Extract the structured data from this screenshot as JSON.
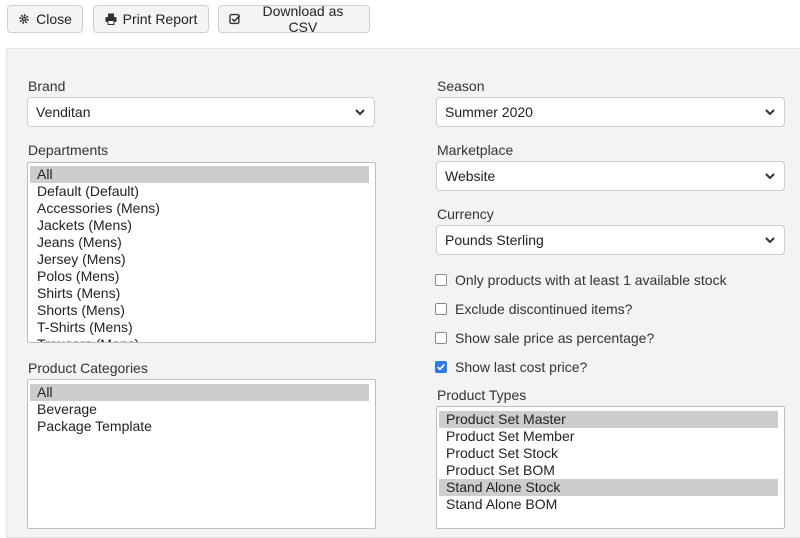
{
  "toolbar": {
    "close_label": "Close",
    "print_label": "Print Report",
    "csv_label": "Download as CSV"
  },
  "form": {
    "brand": {
      "label": "Brand",
      "value": "Venditan"
    },
    "departments": {
      "label": "Departments",
      "options": [
        {
          "text": "All",
          "selected": true
        },
        {
          "text": "Default (Default)",
          "selected": false
        },
        {
          "text": "Accessories (Mens)",
          "selected": false
        },
        {
          "text": "Jackets (Mens)",
          "selected": false
        },
        {
          "text": "Jeans (Mens)",
          "selected": false
        },
        {
          "text": "Jersey (Mens)",
          "selected": false
        },
        {
          "text": "Polos (Mens)",
          "selected": false
        },
        {
          "text": "Shirts (Mens)",
          "selected": false
        },
        {
          "text": "Shorts (Mens)",
          "selected": false
        },
        {
          "text": "T-Shirts (Mens)",
          "selected": false
        },
        {
          "text": "Trousers (Mens)",
          "selected": false
        }
      ]
    },
    "product_categories": {
      "label": "Product Categories",
      "options": [
        {
          "text": "All",
          "selected": true
        },
        {
          "text": "Beverage",
          "selected": false
        },
        {
          "text": "Package Template",
          "selected": false
        }
      ]
    },
    "season": {
      "label": "Season",
      "value": "Summer 2020"
    },
    "marketplace": {
      "label": "Marketplace",
      "value": "Website"
    },
    "currency": {
      "label": "Currency",
      "value": "Pounds Sterling"
    },
    "checkboxes": [
      {
        "label": "Only products with at least 1 available stock",
        "checked": false
      },
      {
        "label": "Exclude discontinued items?",
        "checked": false
      },
      {
        "label": "Show sale price as percentage?",
        "checked": false
      },
      {
        "label": "Show last cost price?",
        "checked": true
      }
    ],
    "product_types": {
      "label": "Product Types",
      "options": [
        {
          "text": "Product Set Master",
          "selected": true
        },
        {
          "text": "Product Set Member",
          "selected": false
        },
        {
          "text": "Product Set Stock",
          "selected": false
        },
        {
          "text": "Product Set BOM",
          "selected": false
        },
        {
          "text": "Stand Alone Stock",
          "selected": true
        },
        {
          "text": "Stand Alone BOM",
          "selected": false
        }
      ]
    }
  },
  "colors": {
    "accent": "#2f7be4",
    "panel_bg": "#f3f3f3",
    "selected_option": "#cdcdcd"
  }
}
